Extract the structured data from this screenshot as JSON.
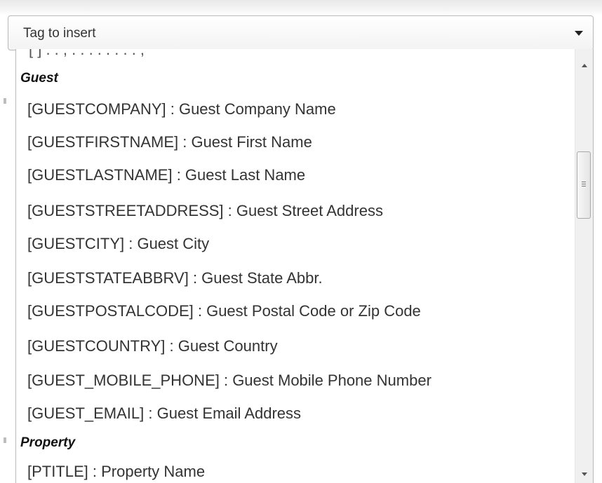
{
  "select": {
    "placeholder": "Tag to insert",
    "arrow_icon": "caret-down-icon"
  },
  "dropdown": {
    "cut_off_row": "[                         ]   .   .  ,   .      .   .   .     .   .   .          .   ,",
    "groups": [
      {
        "label": "Guest",
        "options": [
          "[GUESTCOMPANY] : Guest Company Name",
          "[GUESTFIRSTNAME] : Guest First Name",
          "[GUESTLASTNAME] : Guest Last Name",
          "[GUESTSTREETADDRESS] : Guest Street Address",
          "[GUESTCITY] : Guest City",
          "[GUESTSTATEABBRV] : Guest State Abbr.",
          "[GUESTPOSTALCODE] : Guest Postal Code or Zip Code",
          "[GUESTCOUNTRY] : Guest Country",
          "[GUEST_MOBILE_PHONE] : Guest Mobile Phone Number",
          "[GUEST_EMAIL] : Guest Email Address"
        ]
      },
      {
        "label": "Property",
        "options": [
          "[PTITLE] : Property Name"
        ]
      }
    ]
  },
  "scrollbar": {
    "up_icon": "scroll-up-arrow-icon",
    "down_icon": "scroll-down-arrow-icon",
    "thumb_grip_icon": "grip-lines-icon"
  },
  "colors": {
    "text": "#333333",
    "group_label": "#111111",
    "border": "#b9b9b9",
    "scrollbar_track": "#f0f0f0"
  }
}
